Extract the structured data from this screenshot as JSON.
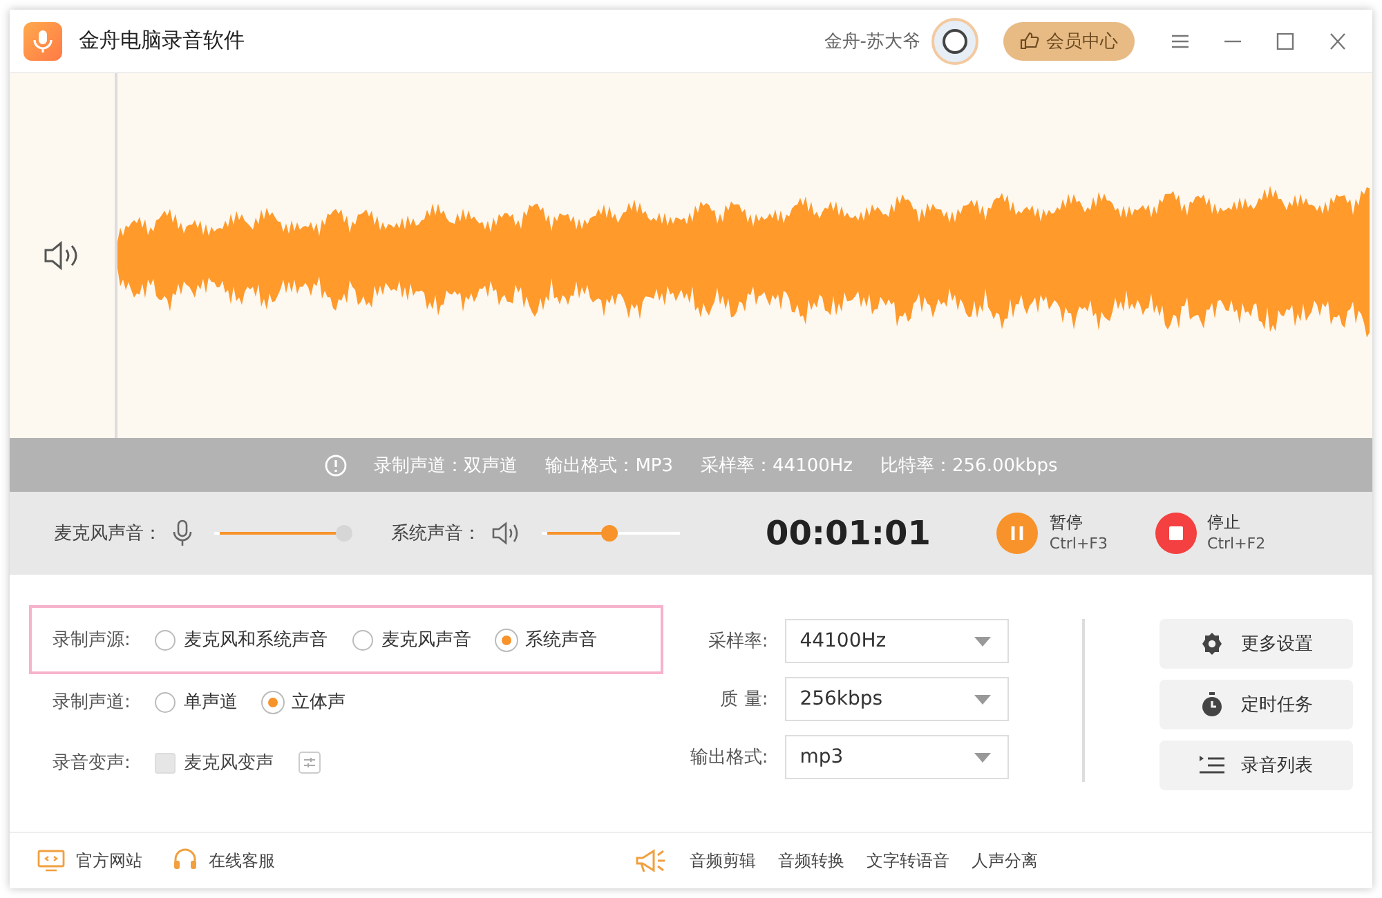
{
  "window": {
    "title": "金舟电脑录音软件",
    "user": "金舟-苏大爷",
    "vip_button": "会员中心"
  },
  "info_bar": [
    "录制声道：双声道",
    "输出格式：MP3",
    "采样率：44100Hz",
    "比特率：256.00kbps"
  ],
  "controls": {
    "mic": {
      "label": "麦克风声音：",
      "level": 1.0,
      "disabled": true
    },
    "system": {
      "label": "系统声音：",
      "level": 0.5,
      "disabled": false
    },
    "timer": "00:01:01",
    "buttons": [
      {
        "kind": "pause",
        "label": "暂停",
        "shortcut": "Ctrl+F3"
      },
      {
        "kind": "stop",
        "label": "停止",
        "shortcut": "Ctrl+F2"
      }
    ]
  },
  "settings": {
    "source": {
      "label": "录制声源:",
      "options": [
        {
          "label": "麦克风和系统声音",
          "selected": false
        },
        {
          "label": "麦克风声音",
          "selected": false
        },
        {
          "label": "系统声音",
          "selected": true
        }
      ]
    },
    "channel": {
      "label": "录制声道:",
      "options": [
        {
          "label": "单声道",
          "selected": false
        },
        {
          "label": "立体声",
          "selected": true
        }
      ]
    },
    "voice_change": {
      "label": "录音变声:",
      "checkbox": "麦克风变声",
      "checked": false,
      "disabled": true
    },
    "selects": [
      {
        "label": "采样率:",
        "value": "44100Hz"
      },
      {
        "label": "质 量:",
        "value": "256kbps"
      },
      {
        "label": "输出格式:",
        "value": "mp3"
      }
    ],
    "actions": [
      {
        "kind": "settings",
        "label": "更多设置"
      },
      {
        "kind": "timer",
        "label": "定时任务"
      },
      {
        "kind": "list",
        "label": "录音列表"
      }
    ]
  },
  "footer": {
    "left": [
      {
        "kind": "website",
        "label": "官方网站"
      },
      {
        "kind": "support",
        "label": "在线客服"
      }
    ],
    "tools": [
      "音频剪辑",
      "音频转换",
      "文字转语音",
      "人声分离"
    ]
  }
}
